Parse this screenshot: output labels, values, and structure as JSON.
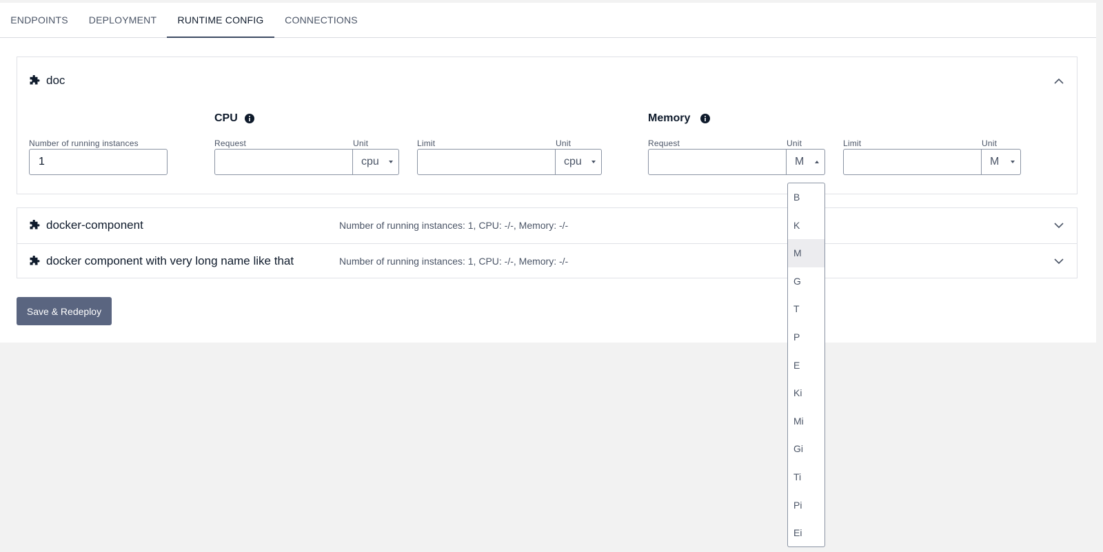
{
  "tabs": [
    {
      "label": "ENDPOINTS"
    },
    {
      "label": "DEPLOYMENT"
    },
    {
      "label": "RUNTIME CONFIG",
      "active": true
    },
    {
      "label": "CONNECTIONS"
    }
  ],
  "doc": {
    "name": "doc",
    "instances_label": "Number of running instances",
    "instances_value": "1",
    "cpu": {
      "title": "CPU",
      "request_label": "Request",
      "request_unit_label": "Unit",
      "request_unit": "cpu",
      "limit_label": "Limit",
      "limit_unit_label": "Unit",
      "limit_unit": "cpu"
    },
    "memory": {
      "title": "Memory",
      "request_label": "Request",
      "request_unit_label": "Unit",
      "request_unit": "M",
      "limit_label": "Limit",
      "limit_unit_label": "Unit",
      "limit_unit": "M"
    }
  },
  "components": [
    {
      "name": "docker-component",
      "summary": "Number of running instances: 1, CPU: -/-, Memory: -/-"
    },
    {
      "name": "docker component with very long name like that",
      "summary": "Number of running instances: 1, CPU: -/-, Memory: -/-"
    }
  ],
  "save_button": "Save & Redeploy",
  "memory_unit_dropdown": {
    "selected": "M",
    "options": [
      "B",
      "K",
      "M",
      "G",
      "T",
      "P",
      "E",
      "Ki",
      "Mi",
      "Gi",
      "Ti",
      "Pi",
      "Ei"
    ]
  },
  "icons": {
    "component": "puzzle-icon",
    "info": "info-icon",
    "expand": "chevron-down-icon",
    "collapse": "chevron-up-icon"
  },
  "colors": {
    "text": "#0e1a2b",
    "muted": "#4a5466",
    "button": "#5a6580",
    "tab_active_underline": "#3d4b63",
    "background": "#f2f2f2"
  }
}
